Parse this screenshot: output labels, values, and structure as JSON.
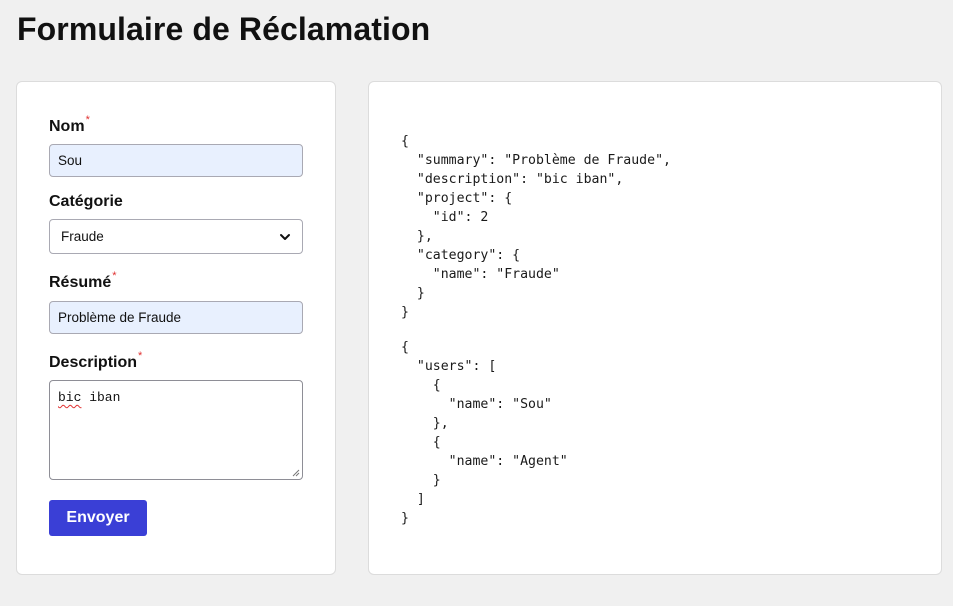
{
  "page": {
    "title": "Formulaire de Réclamation"
  },
  "form": {
    "nom": {
      "label": "Nom",
      "required_mark": "*",
      "value": "Sou"
    },
    "categorie": {
      "label": "Catégorie",
      "selected": "Fraude"
    },
    "resume": {
      "label": "Résumé",
      "required_mark": "*",
      "value": "Problème de Fraude"
    },
    "description": {
      "label": "Description",
      "required_mark": "*",
      "value_word1": "bic",
      "value_word2": " iban"
    },
    "submit_label": "Envoyer"
  },
  "json_preview": {
    "block1": "{\n  \"summary\": \"Problème de Fraude\",\n  \"description\": \"bic iban\",\n  \"project\": {\n    \"id\": 2\n  },\n  \"category\": {\n    \"name\": \"Fraude\"\n  }\n}",
    "block2": "{\n  \"users\": [\n    {\n      \"name\": \"Sou\"\n    },\n    {\n      \"name\": \"Agent\"\n    }\n  ]\n}"
  },
  "colors": {
    "background": "#f0f0f0",
    "button": "#3a3fd6",
    "required": "#e03030",
    "autofill": "#e8f0fe"
  },
  "icons": {
    "select_arrow": "chevron-down-icon",
    "resize": "resize-handle-icon"
  }
}
